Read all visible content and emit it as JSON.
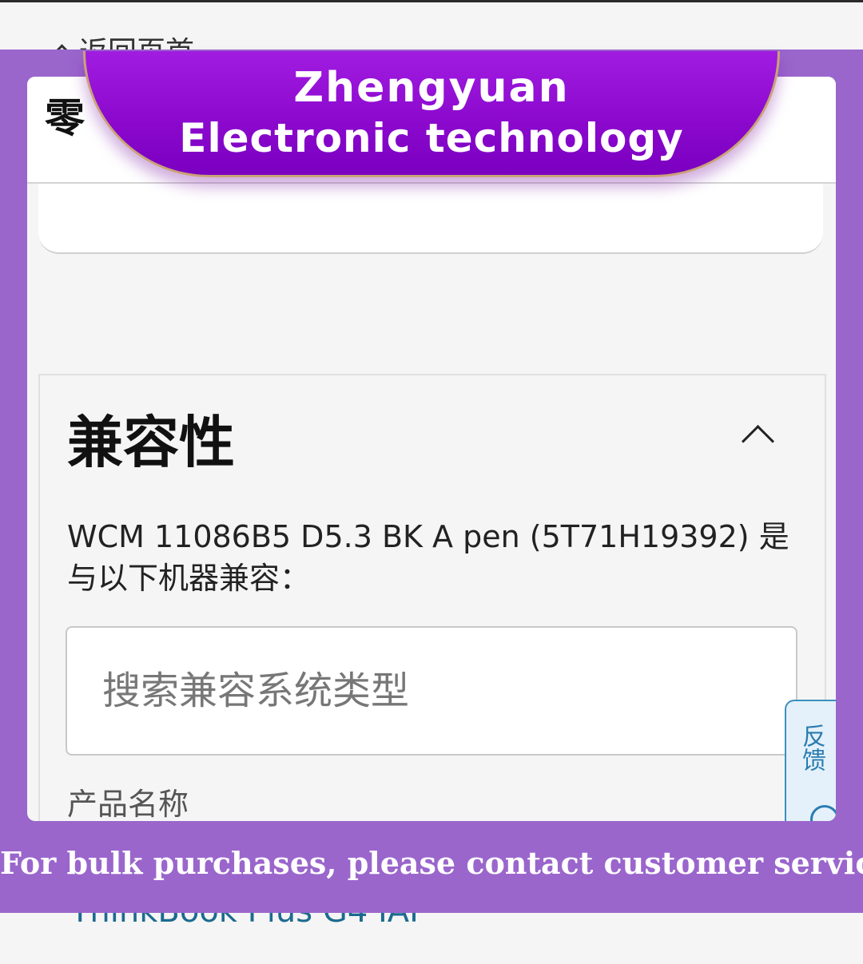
{
  "underlay": {
    "back_label": "返回页首",
    "bottom_item": "ThinkBook Plus G4 IAP"
  },
  "header": {
    "title": "零"
  },
  "banner": {
    "line1": "Zhengyuan",
    "line2": "Electronic technology"
  },
  "compatibility": {
    "title": "兼容性",
    "description": "WCM 11086B5 D5.3 BK A pen (5T71H19392) 是与以下机器兼容：",
    "search_placeholder": "搜索兼容系统类型",
    "column_label": "产品名称"
  },
  "feedback": {
    "label": "反馈",
    "icon": "smile-icon"
  },
  "promo": {
    "text": "For bulk purchases, please contact customer service"
  },
  "colors": {
    "frame": "#9a66cc",
    "banner": "#8a08cc",
    "link": "#1c6b8f",
    "feedback": "#2a7cb0"
  }
}
